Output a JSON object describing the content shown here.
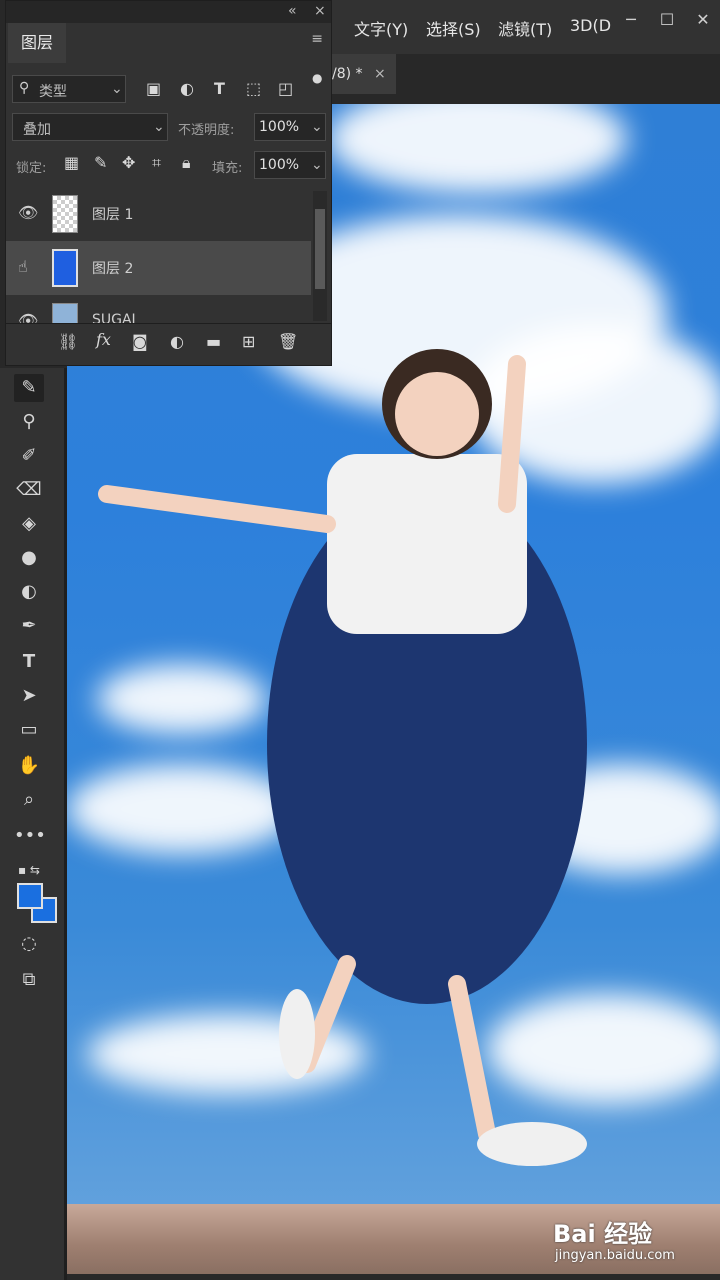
{
  "menu": {
    "items": [
      "文字(Y)",
      "选择(S)",
      "滤镜(T)",
      "3D(D"
    ],
    "window_controls": [
      "─",
      "☐",
      "✕"
    ]
  },
  "document_tab": {
    "label": "/8) *",
    "close": "×"
  },
  "layers_panel": {
    "collapse": "«",
    "close": "×",
    "tab_label": "图层",
    "menu_icon": "≡",
    "filter": {
      "label": "类型",
      "icon": "search-icon"
    },
    "blend_mode": "叠加",
    "opacity_label": "不透明度:",
    "opacity_value": "100%",
    "lock_label": "锁定:",
    "fill_label": "填充:",
    "fill_value": "100%",
    "layers": [
      {
        "name": "图层 1",
        "visible": true,
        "selected": false
      },
      {
        "name": "图层 2",
        "visible": true,
        "selected": true
      },
      {
        "name": "SUGAI",
        "visible": true,
        "selected": false
      }
    ]
  },
  "colors": {
    "foreground": "#1a6fe0",
    "background": "#1a6fe0",
    "selected_row": "#4a4a4a"
  },
  "watermark": {
    "brand": "Bai 经验",
    "url": "jingyan.baidu.com"
  }
}
